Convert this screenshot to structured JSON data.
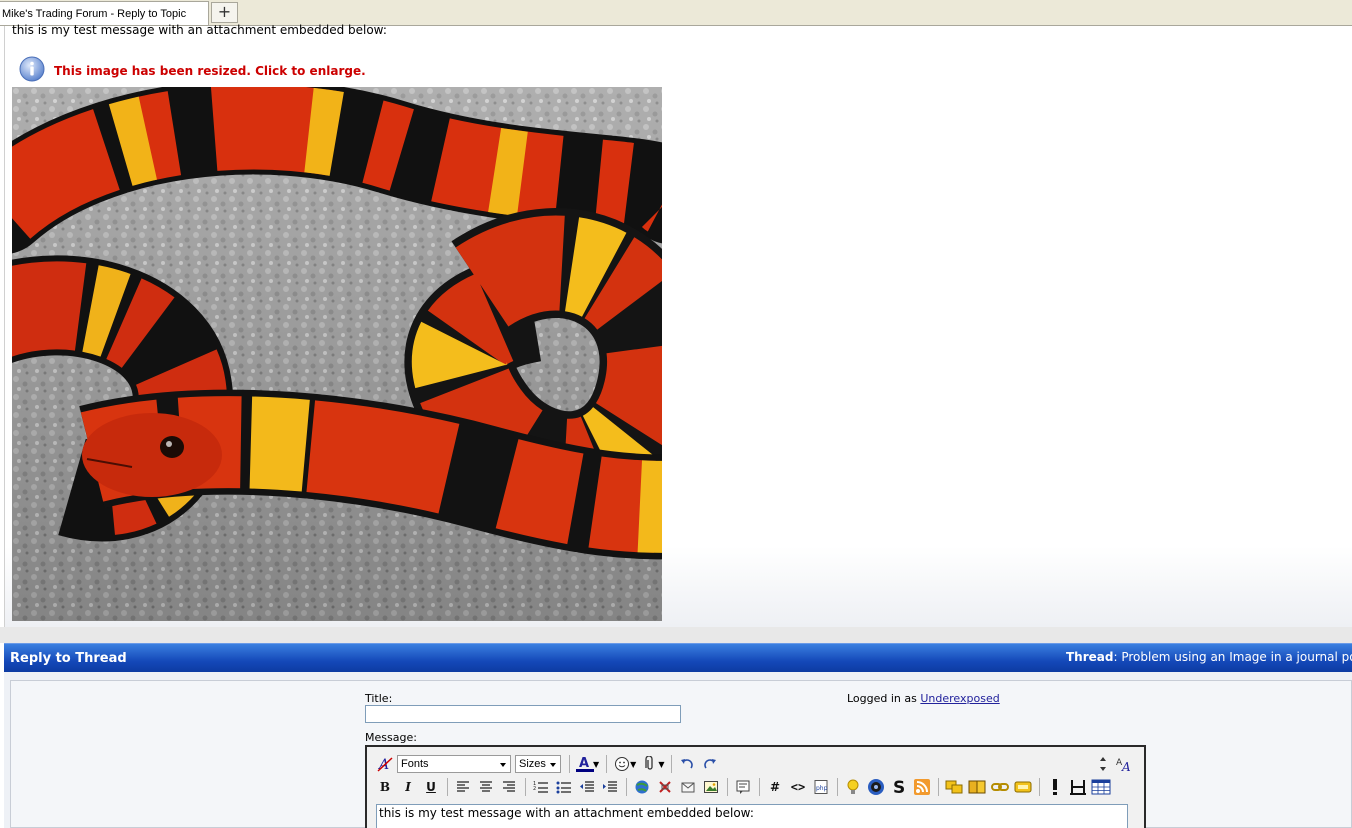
{
  "browser": {
    "tab_title": "Mike's Trading Forum - Reply to Topic",
    "new_tab_label": "+"
  },
  "post": {
    "message_text": "this is my test message with an attachment embedded below:",
    "resize_notice": "This image has been resized.  Click to enlarge.",
    "image_subject": "coral snake photo"
  },
  "reply": {
    "header_title": "Reply to Thread",
    "thread_label": "Thread",
    "thread_title": ": Problem using an Image in a journal pos"
  },
  "form": {
    "title_label": "Title:",
    "title_value": "",
    "message_label": "Message:",
    "logged_in_prefix": "Logged in as ",
    "username": "Underexposed"
  },
  "editor": {
    "font_select": "Fonts",
    "size_select": "Sizes",
    "text_color": "#000080",
    "bold": "B",
    "italic": "I",
    "underline": "U",
    "hash": "#",
    "code": "<>",
    "php": "php",
    "message_value": "this is my test message with an attachment embedded below:"
  },
  "colors": {
    "header_blue": "#1448b8",
    "notice_red": "#cc0000",
    "link_blue": "#22229c"
  }
}
